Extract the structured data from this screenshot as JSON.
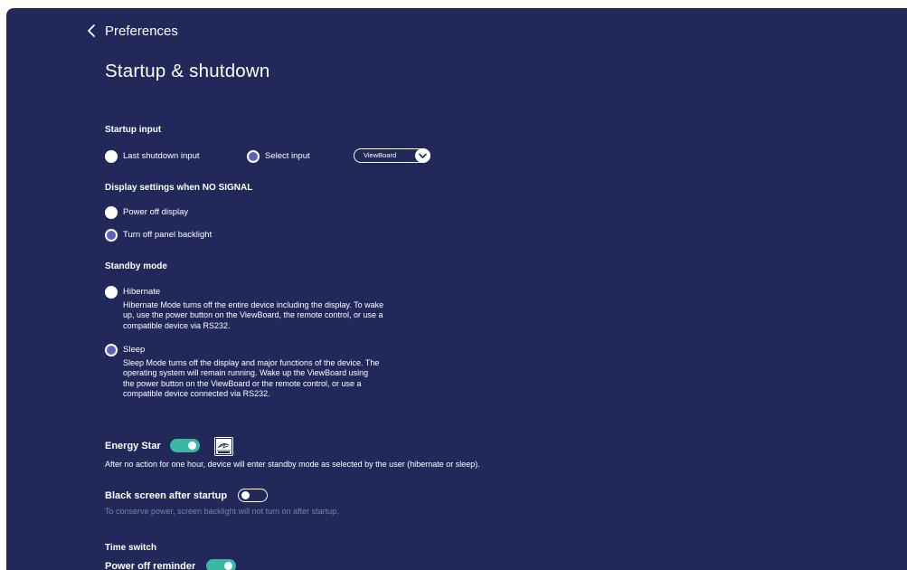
{
  "header": {
    "back_label": "Preferences",
    "title": "Startup & shutdown"
  },
  "startup_input": {
    "heading": "Startup input",
    "options": [
      {
        "label": "Last shutdown input",
        "selected": false
      },
      {
        "label": "Select input",
        "selected": true
      }
    ],
    "select_value": "ViewBoard"
  },
  "no_signal": {
    "heading": "Display settings when NO SIGNAL",
    "options": [
      {
        "label": "Power off display",
        "selected": false
      },
      {
        "label": "Turn off panel backlight",
        "selected": true
      }
    ]
  },
  "standby": {
    "heading": "Standby mode",
    "options": [
      {
        "label": "Hibernate",
        "selected": false,
        "description": "Hibernate Mode turns off the entire device including the display. To wake up, use the power button on the ViewBoard, the remote control, or use a compatible device via RS232."
      },
      {
        "label": "Sleep",
        "selected": true,
        "description": "Sleep Mode turns off the display and major functions of the device. The operating system will remain running. Wake up the ViewBoard using the power button on the ViewBoard or the remote control, or use a compatible device connected via RS232."
      }
    ]
  },
  "energy_star": {
    "label": "Energy Star",
    "enabled": true,
    "logo_icon": "energy-star-logo",
    "description": "After no action for one hour, device will enter standby mode as selected by the user (hibernate or sleep)."
  },
  "black_screen": {
    "label": "Black screen after startup",
    "enabled": false,
    "description": "To conserve power, screen backlight will not turn on after startup."
  },
  "time_switch": {
    "heading": "Time switch",
    "power_off_reminder": {
      "label": "Power off reminder",
      "enabled": true
    }
  },
  "colors": {
    "background": "#22285a",
    "toggle_on": "#3bb8a4",
    "radio_selected": "#5a64b8",
    "dimmed_text": "#7c82a4"
  }
}
